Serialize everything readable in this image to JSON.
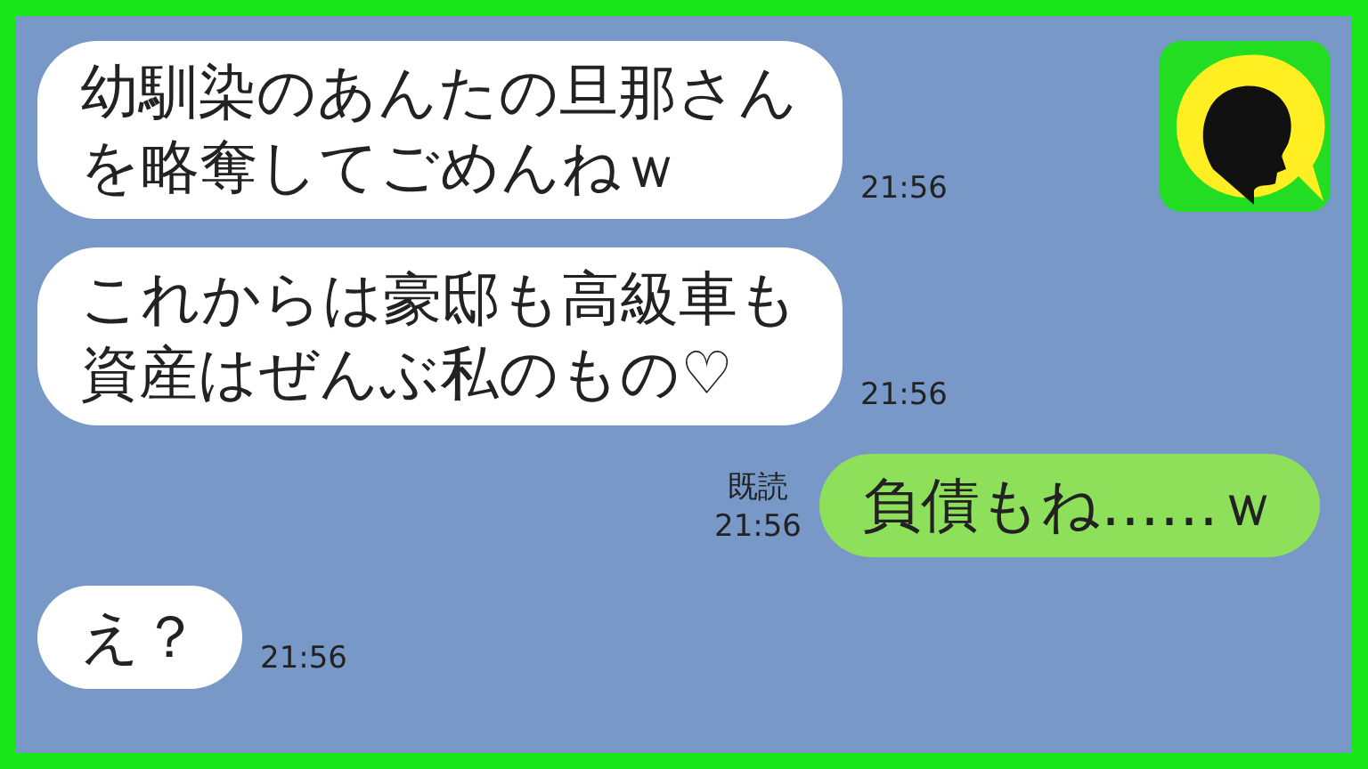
{
  "messages": [
    {
      "kind": "received",
      "text": "幼馴染のあんたの旦那さんを略奪してごめんねｗ",
      "time": "21:56"
    },
    {
      "kind": "received",
      "text": "これからは豪邸も高級車も資産はぜんぶ私のもの♡",
      "time": "21:56"
    },
    {
      "kind": "sent",
      "text": "負債もね……ｗ",
      "read": "既読",
      "time": "21:56"
    },
    {
      "kind": "received",
      "text": "え？",
      "time": "21:56"
    }
  ]
}
